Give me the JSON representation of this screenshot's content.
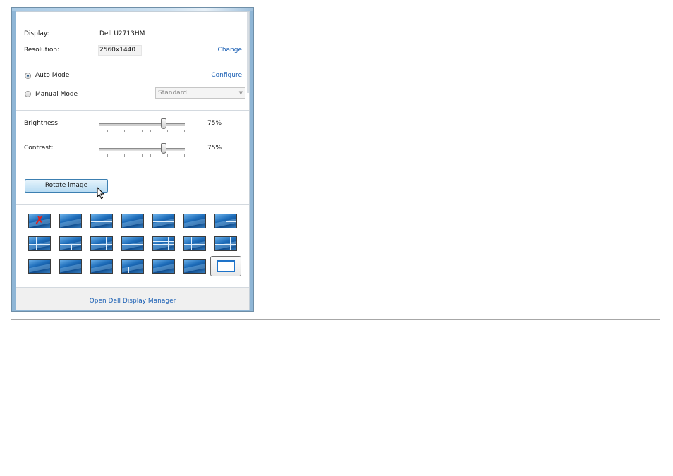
{
  "display_row": {
    "label": "Display:",
    "value": "Dell U2713HM"
  },
  "resolution_row": {
    "label": "Resolution:",
    "value": "2560x1440",
    "change_link": "Change"
  },
  "mode": {
    "auto_label": "Auto Mode",
    "configure_link": "Configure",
    "manual_label": "Manual Mode",
    "preset_selected": "Standard",
    "auto_selected": true
  },
  "brightness": {
    "label": "Brightness:",
    "value_text": "75%",
    "level": 75
  },
  "contrast": {
    "label": "Contrast:",
    "value_text": "75%",
    "level": 75
  },
  "rotate_button": "Rotate image",
  "layout_grid": {
    "rows": 3,
    "columns": 7,
    "selected_index": 20,
    "disabled_index": 0
  },
  "footer": {
    "open_link": "Open Dell Display Manager"
  },
  "colors": {
    "link": "#1a5fb4",
    "tile_blue": "#0f4e8f",
    "disabled_x": "#e0201b",
    "selected_border": "#1e73c9"
  },
  "icons": {
    "pointer": "arrow-cursor-icon",
    "disabled": "red-x-icon"
  }
}
